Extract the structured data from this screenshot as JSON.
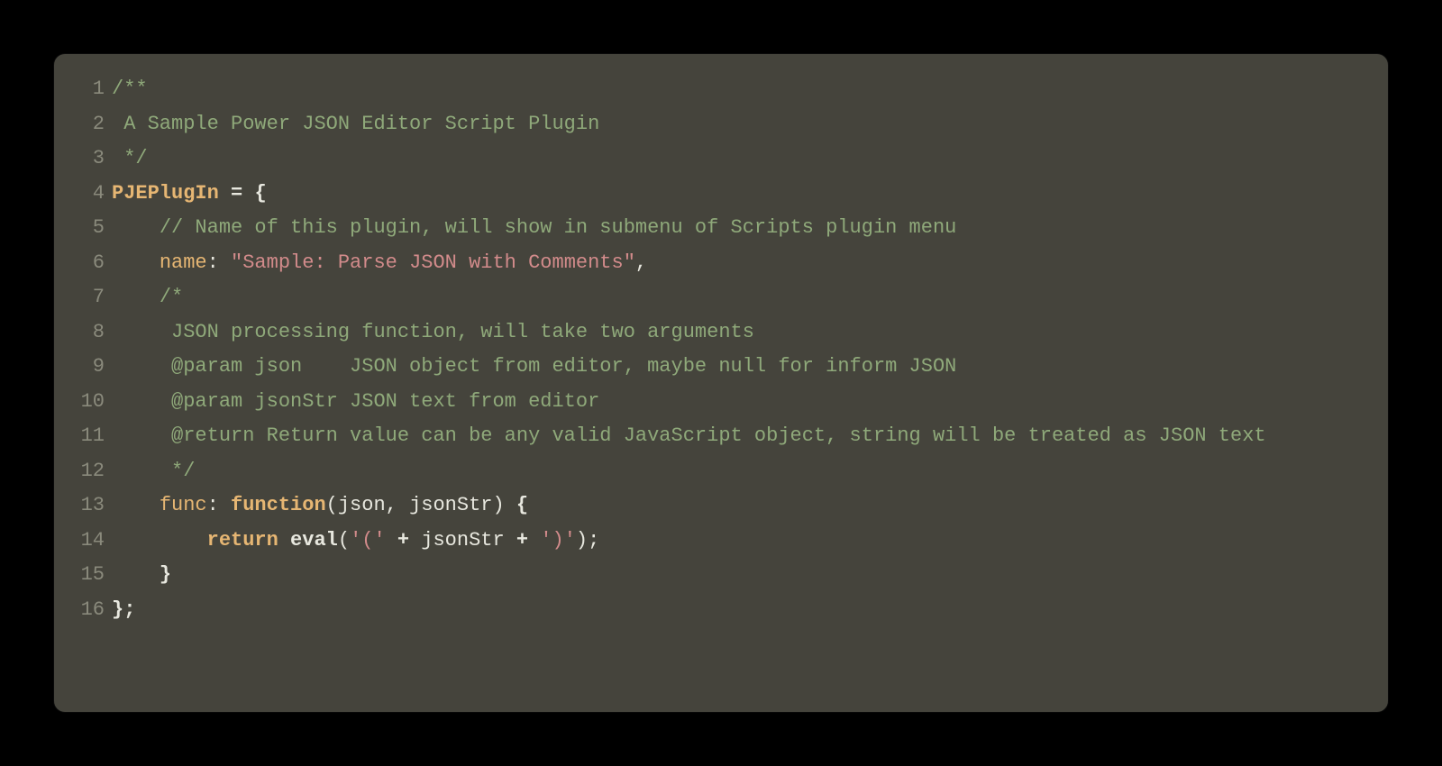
{
  "colors": {
    "background": "#000000",
    "editor_bg": "#45443c",
    "lineno": "#8a8a7c",
    "comment": "#8fa97a",
    "key": "#e6b673",
    "string": "#d28b8b",
    "keyword": "#e6b673",
    "default": "#e8e8df"
  },
  "code": {
    "lines": [
      {
        "n": "1",
        "tokens": [
          {
            "cls": "comment",
            "t": "/**"
          }
        ]
      },
      {
        "n": "2",
        "tokens": [
          {
            "cls": "comment",
            "t": " A Sample Power JSON Editor Script Plugin"
          }
        ]
      },
      {
        "n": "3",
        "tokens": [
          {
            "cls": "comment",
            "t": " */"
          }
        ]
      },
      {
        "n": "4",
        "tokens": [
          {
            "cls": "ident",
            "t": "PJEPlugIn"
          },
          {
            "cls": "plain",
            "t": " "
          },
          {
            "cls": "op",
            "t": "="
          },
          {
            "cls": "plain",
            "t": " "
          },
          {
            "cls": "punc",
            "t": "{"
          }
        ]
      },
      {
        "n": "5",
        "tokens": [
          {
            "cls": "plain",
            "t": "    "
          },
          {
            "cls": "comment",
            "t": "// Name of this plugin, will show in submenu of Scripts plugin menu"
          }
        ]
      },
      {
        "n": "6",
        "tokens": [
          {
            "cls": "plain",
            "t": "    "
          },
          {
            "cls": "key",
            "t": "name"
          },
          {
            "cls": "plain",
            "t": ": "
          },
          {
            "cls": "string",
            "t": "\"Sample: Parse JSON with Comments\""
          },
          {
            "cls": "plain",
            "t": ","
          }
        ]
      },
      {
        "n": "7",
        "tokens": [
          {
            "cls": "plain",
            "t": "    "
          },
          {
            "cls": "comment",
            "t": "/*"
          }
        ]
      },
      {
        "n": "8",
        "tokens": [
          {
            "cls": "plain",
            "t": "    "
          },
          {
            "cls": "comment",
            "t": " JSON processing function, will take two arguments"
          }
        ]
      },
      {
        "n": "9",
        "tokens": [
          {
            "cls": "plain",
            "t": "    "
          },
          {
            "cls": "comment",
            "t": " @param json    JSON object from editor, maybe null for inform JSON"
          }
        ]
      },
      {
        "n": "10",
        "tokens": [
          {
            "cls": "plain",
            "t": "    "
          },
          {
            "cls": "comment",
            "t": " @param jsonStr JSON text from editor"
          }
        ]
      },
      {
        "n": "11",
        "tokens": [
          {
            "cls": "plain",
            "t": "    "
          },
          {
            "cls": "comment",
            "t": " @return Return value can be any valid JavaScript object, string will be treated as JSON text"
          }
        ]
      },
      {
        "n": "12",
        "tokens": [
          {
            "cls": "plain",
            "t": "    "
          },
          {
            "cls": "comment",
            "t": " */"
          }
        ]
      },
      {
        "n": "13",
        "tokens": [
          {
            "cls": "plain",
            "t": "    "
          },
          {
            "cls": "key",
            "t": "func"
          },
          {
            "cls": "plain",
            "t": ": "
          },
          {
            "cls": "kw",
            "t": "function"
          },
          {
            "cls": "plain",
            "t": "("
          },
          {
            "cls": "param",
            "t": "json"
          },
          {
            "cls": "plain",
            "t": ", "
          },
          {
            "cls": "param",
            "t": "jsonStr"
          },
          {
            "cls": "plain",
            "t": ") "
          },
          {
            "cls": "punc",
            "t": "{"
          }
        ]
      },
      {
        "n": "14",
        "tokens": [
          {
            "cls": "plain",
            "t": "        "
          },
          {
            "cls": "kw",
            "t": "return"
          },
          {
            "cls": "plain",
            "t": " "
          },
          {
            "cls": "fn",
            "t": "eval"
          },
          {
            "cls": "plain",
            "t": "("
          },
          {
            "cls": "string",
            "t": "'('"
          },
          {
            "cls": "plain",
            "t": " "
          },
          {
            "cls": "op",
            "t": "+"
          },
          {
            "cls": "plain",
            "t": " jsonStr "
          },
          {
            "cls": "op",
            "t": "+"
          },
          {
            "cls": "plain",
            "t": " "
          },
          {
            "cls": "string",
            "t": "')'"
          },
          {
            "cls": "plain",
            "t": ");"
          }
        ]
      },
      {
        "n": "15",
        "tokens": [
          {
            "cls": "plain",
            "t": "    "
          },
          {
            "cls": "punc",
            "t": "}"
          }
        ]
      },
      {
        "n": "16",
        "tokens": [
          {
            "cls": "punc",
            "t": "};"
          }
        ]
      }
    ]
  }
}
